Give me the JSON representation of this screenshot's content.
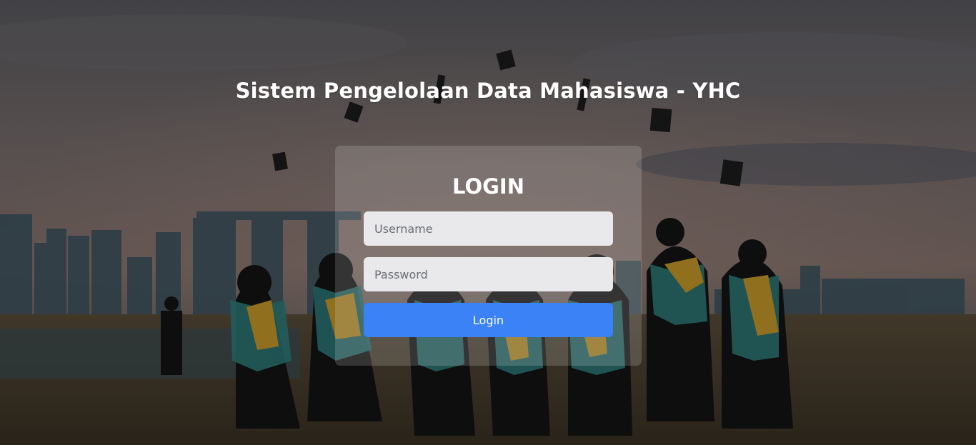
{
  "page": {
    "title": "Sistem Pengelolaan Data Mahasiswa - YHC"
  },
  "login_form": {
    "heading": "LOGIN",
    "username_placeholder": "Username",
    "password_placeholder": "Password",
    "submit_label": "Login"
  },
  "colors": {
    "button": "#3b82f6",
    "input_bg": "#e9e9ec",
    "card_bg": "rgba(255,255,255,0.16)",
    "title_text": "#ffffff"
  },
  "background": {
    "subject": "graduation-ceremony-photo"
  }
}
